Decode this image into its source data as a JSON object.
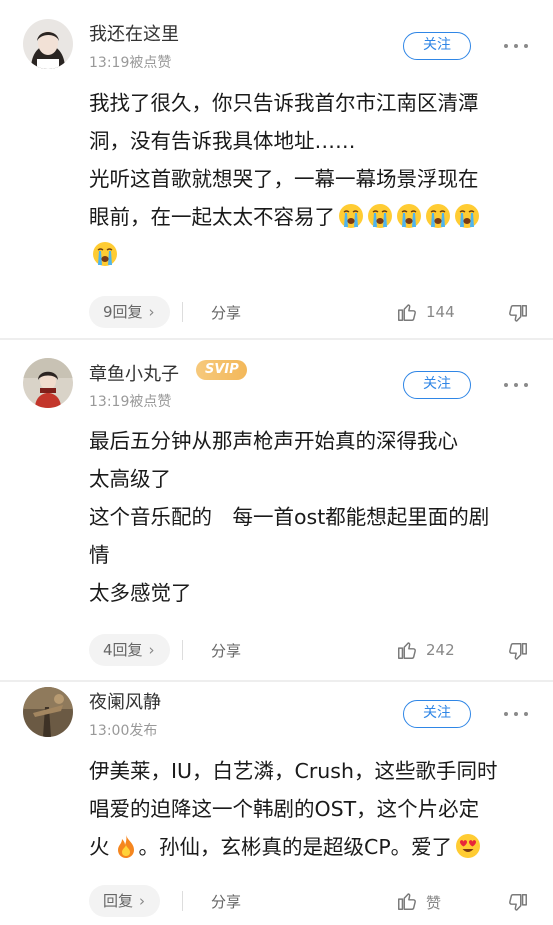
{
  "comments": [
    {
      "username": "我还在这里",
      "meta": "13:19被点赞",
      "follow_label": "关注",
      "lines": [
        "我找了很久，你只告诉我首尔市江南区清潭",
        "洞，没有告诉我具体地址……",
        "光听这首歌就想哭了，一幕一幕场景浮现在",
        "眼前，在一起太太不容易了"
      ],
      "emoji_inline": "crying-face",
      "emoji_inline_count": 5,
      "reply_label": "9回复",
      "share_label": "分享",
      "like_count": "144"
    },
    {
      "username": "章鱼小丸子",
      "badge": "SVIP",
      "meta": "13:19被点赞",
      "follow_label": "关注",
      "lines": [
        "最后五分钟从那声枪声开始真的深得我心",
        "太高级了",
        "这个音乐配的　每一首ost都能想起里面的剧",
        "情",
        "太多感觉了"
      ],
      "reply_label": "4回复",
      "share_label": "分享",
      "like_count": "242"
    },
    {
      "username": "夜阑风静",
      "meta": "13:00发布",
      "follow_label": "关注",
      "lines": [
        "伊美莱，IU，白艺潾，Crush，这些歌手同时",
        "唱爱的迫降这一个韩剧的OST，这个片必定",
        "火",
        "。孙仙，玄彬真的是超级CP。爱了"
      ],
      "reply_label": "回复",
      "share_label": "分享",
      "like_count": "赞"
    }
  ],
  "icons": {
    "more": "more-dots-icon",
    "chevron": "chevron-right-icon",
    "like": "thumbs-up-icon",
    "dislike": "thumbs-down-icon",
    "fire": "fire-emoji",
    "heart_eyes": "heart-eyes-emoji"
  },
  "colors": {
    "accent": "#2f86e6",
    "svip": "#f3b85a",
    "meta": "#999999"
  }
}
